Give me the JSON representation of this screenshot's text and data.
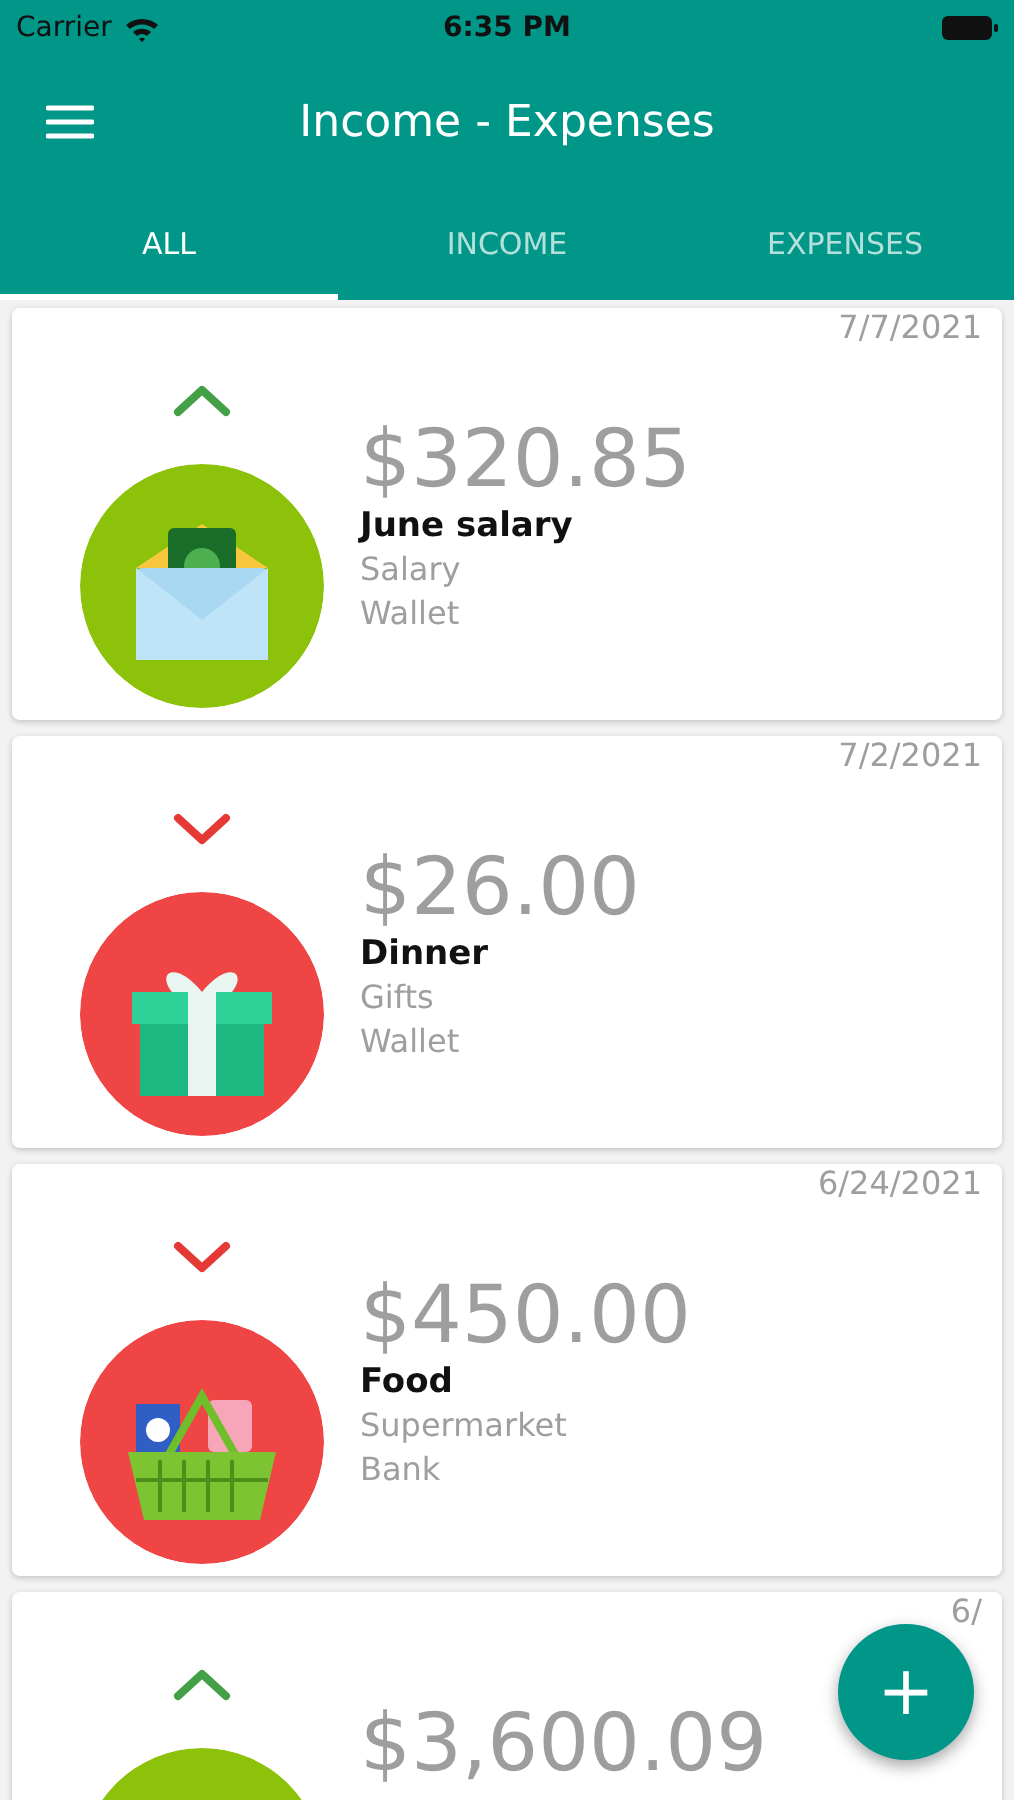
{
  "status_bar": {
    "carrier": "Carrier",
    "time": "6:35 PM"
  },
  "header": {
    "title": "Income - Expenses"
  },
  "tabs": [
    {
      "label": "ALL",
      "selected": true
    },
    {
      "label": "INCOME",
      "selected": false
    },
    {
      "label": "EXPENSES",
      "selected": false
    }
  ],
  "transactions": [
    {
      "income": true,
      "kind": "salary",
      "amount": "$320.85",
      "title": "June salary",
      "category": "Salary",
      "account": "Wallet",
      "date": "7/7/2021"
    },
    {
      "income": false,
      "kind": "gift",
      "amount": "$26.00",
      "title": "Dinner",
      "category": "Gifts",
      "account": "Wallet",
      "date": "7/2/2021"
    },
    {
      "income": false,
      "kind": "basket",
      "amount": "$450.00",
      "title": "Food",
      "category": "Supermarket",
      "account": "Bank",
      "date": "6/24/2021"
    },
    {
      "income": true,
      "amount": "$3,600.09",
      "date": "6/"
    }
  ],
  "fab": {
    "label": "+"
  }
}
